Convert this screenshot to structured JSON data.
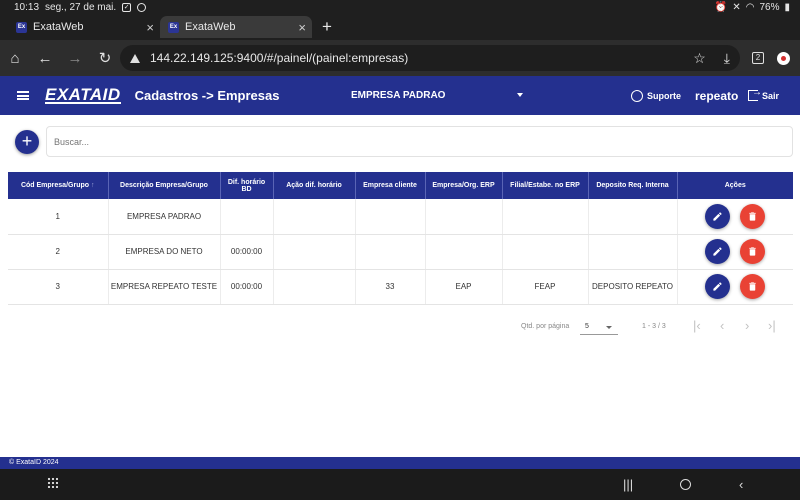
{
  "status_bar": {
    "time": "10:13",
    "date": "seg., 27 de mai.",
    "battery": "76%"
  },
  "browser": {
    "tabs": [
      {
        "title": "ExataWeb",
        "favicon": "Ex"
      },
      {
        "title": "ExataWeb",
        "favicon": "Ex"
      }
    ],
    "url": "144.22.149.125:9400/#/painel/(painel:empresas)",
    "tab_count": "2"
  },
  "app": {
    "logo": "EXATAID",
    "breadcrumb": "Cadastros -> Empresas",
    "company": "EMPRESA PADRAO",
    "support_label": "Suporte",
    "username": "repeato",
    "logout_label": "Sair"
  },
  "search": {
    "placeholder": "Buscar..."
  },
  "table": {
    "columns": [
      "Cód Empresa/Grupo",
      "Descrição Empresa/Grupo",
      "Dif. horário BD",
      "Ação dif. horário",
      "Empresa cliente",
      "Empresa/Org. ERP",
      "Filial/Estabe. no ERP",
      "Deposito Req. Interna",
      "Ações"
    ],
    "rows": [
      [
        "1",
        "EMPRESA PADRAO",
        "",
        "",
        "",
        "",
        "",
        ""
      ],
      [
        "2",
        "EMPRESA DO NETO",
        "00:00:00",
        "",
        "",
        "",
        "",
        ""
      ],
      [
        "3",
        "EMPRESA REPEATO TESTE",
        "00:00:00",
        "",
        "33",
        "EAP",
        "FEAP",
        "DEPOSITO REPEATO"
      ]
    ]
  },
  "paginator": {
    "label": "Qtd. por página",
    "page_size": "5",
    "range": "1 - 3 / 3"
  },
  "footer": {
    "text": "© ExataID 2024"
  },
  "colors": {
    "primary": "#24308f",
    "danger": "#e94234"
  }
}
